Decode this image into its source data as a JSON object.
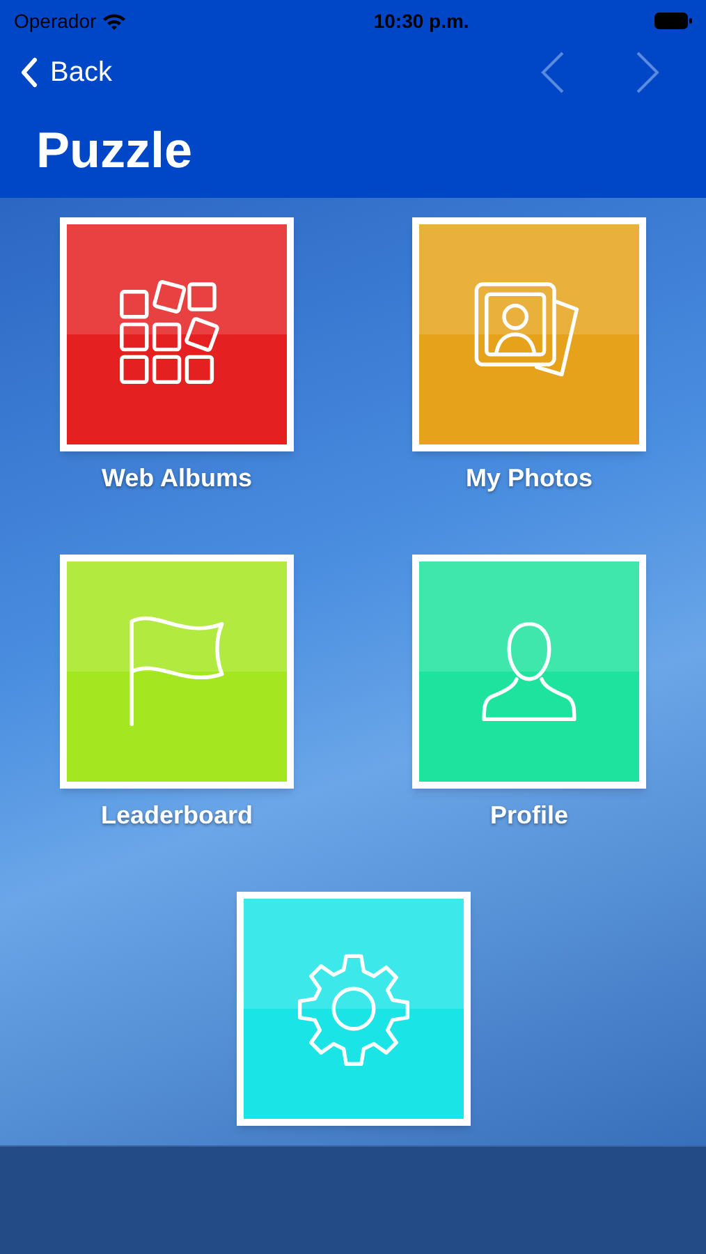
{
  "status_bar": {
    "carrier": "Operador",
    "time": "10:30 p.m."
  },
  "nav": {
    "back": "Back",
    "prev_disabled": true,
    "next_disabled": true
  },
  "title": "Puzzle",
  "tiles": [
    {
      "label": "Web Albums",
      "kind": "grid",
      "color": "#e52020"
    },
    {
      "label": "My Photos",
      "kind": "photos",
      "color": "#e5a21a"
    },
    {
      "label": "Leaderboard",
      "kind": "flag",
      "color": "#a4e61f"
    },
    {
      "label": "Profile",
      "kind": "person",
      "color": "#1ee39f"
    },
    {
      "kind": "gear",
      "color": "#1ae4e5"
    }
  ]
}
